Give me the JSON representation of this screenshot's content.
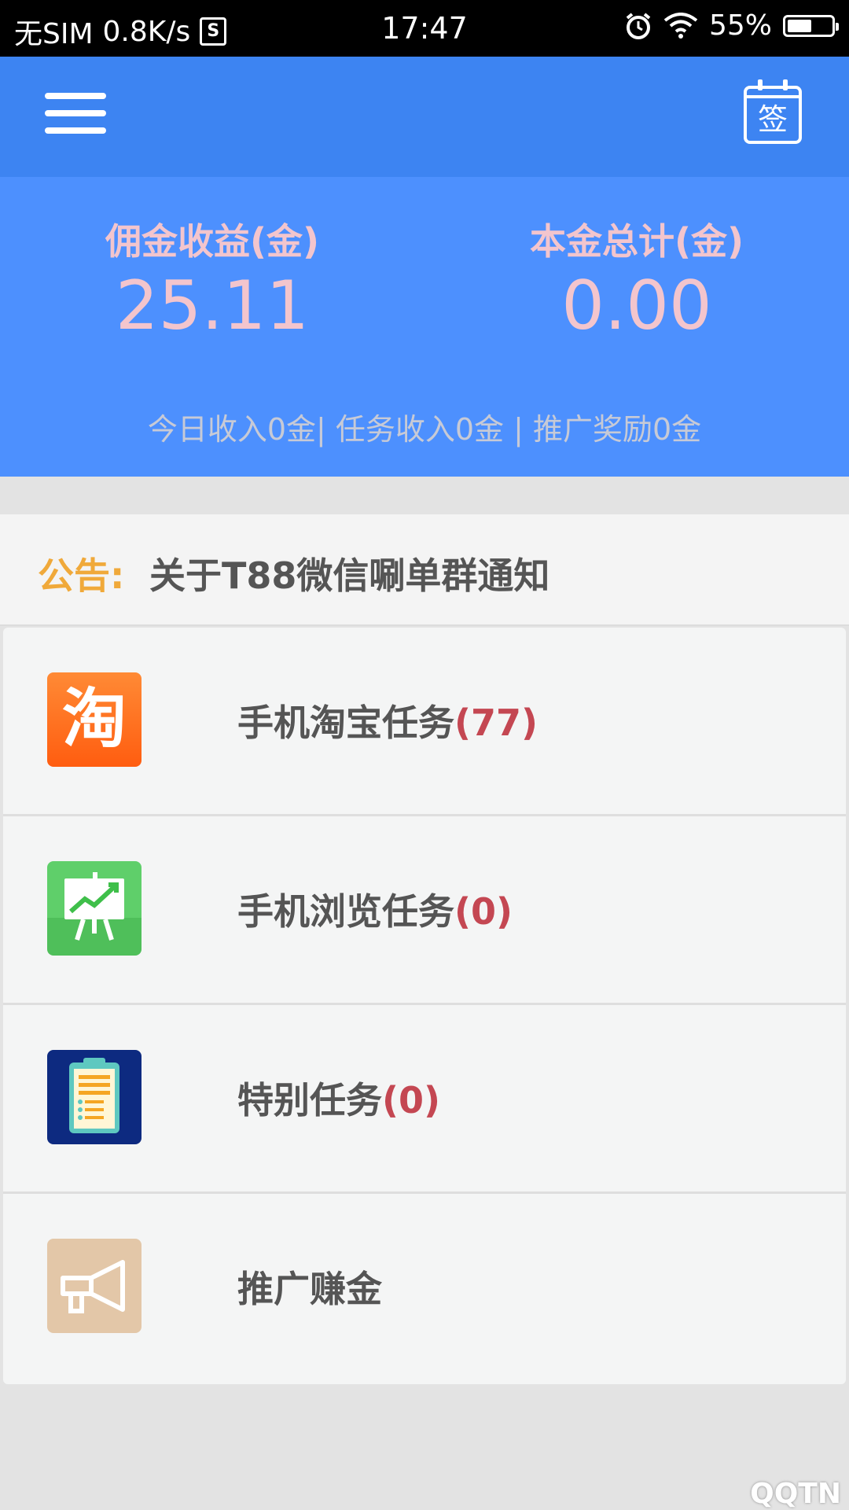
{
  "status_bar": {
    "carrier": "无SIM",
    "speed": "0.8K/s",
    "sim_badge": "S",
    "time": "17:47",
    "battery": "55%",
    "battery_level": 0.55,
    "icons": [
      "alarm-icon",
      "wifi-icon",
      "battery-icon"
    ]
  },
  "app_bar": {
    "menu_icon": "hamburger-menu-icon",
    "sign_in_char": "签"
  },
  "summary": {
    "commission_label": "佣金收益(金)",
    "commission_value": "25.11",
    "principal_label": "本金总计(金)",
    "principal_value": "0.00",
    "income_line": "今日收入0金| 任务收入0金 | 推广奖励0金"
  },
  "announcement": {
    "label": "公告:",
    "text": "关于T88微信唰单群通知"
  },
  "tasks": [
    {
      "icon": "taobao-icon",
      "icon_char": "淘",
      "label": "手机淘宝任务",
      "count": "(77)"
    },
    {
      "icon": "presentation-chart-icon",
      "label": "手机浏览任务",
      "count": "(0)"
    },
    {
      "icon": "clipboard-list-icon",
      "label": "特别任务",
      "count": "(0)"
    },
    {
      "icon": "megaphone-icon",
      "label": "推广赚金",
      "count": ""
    }
  ],
  "colors": {
    "app_bar": "#3d84f2",
    "summary_bg": "#4d90fe",
    "stat_text": "#f3c5cd",
    "announce_label": "#f0a93a",
    "count_red": "#c44752"
  },
  "watermark": "QQTN"
}
